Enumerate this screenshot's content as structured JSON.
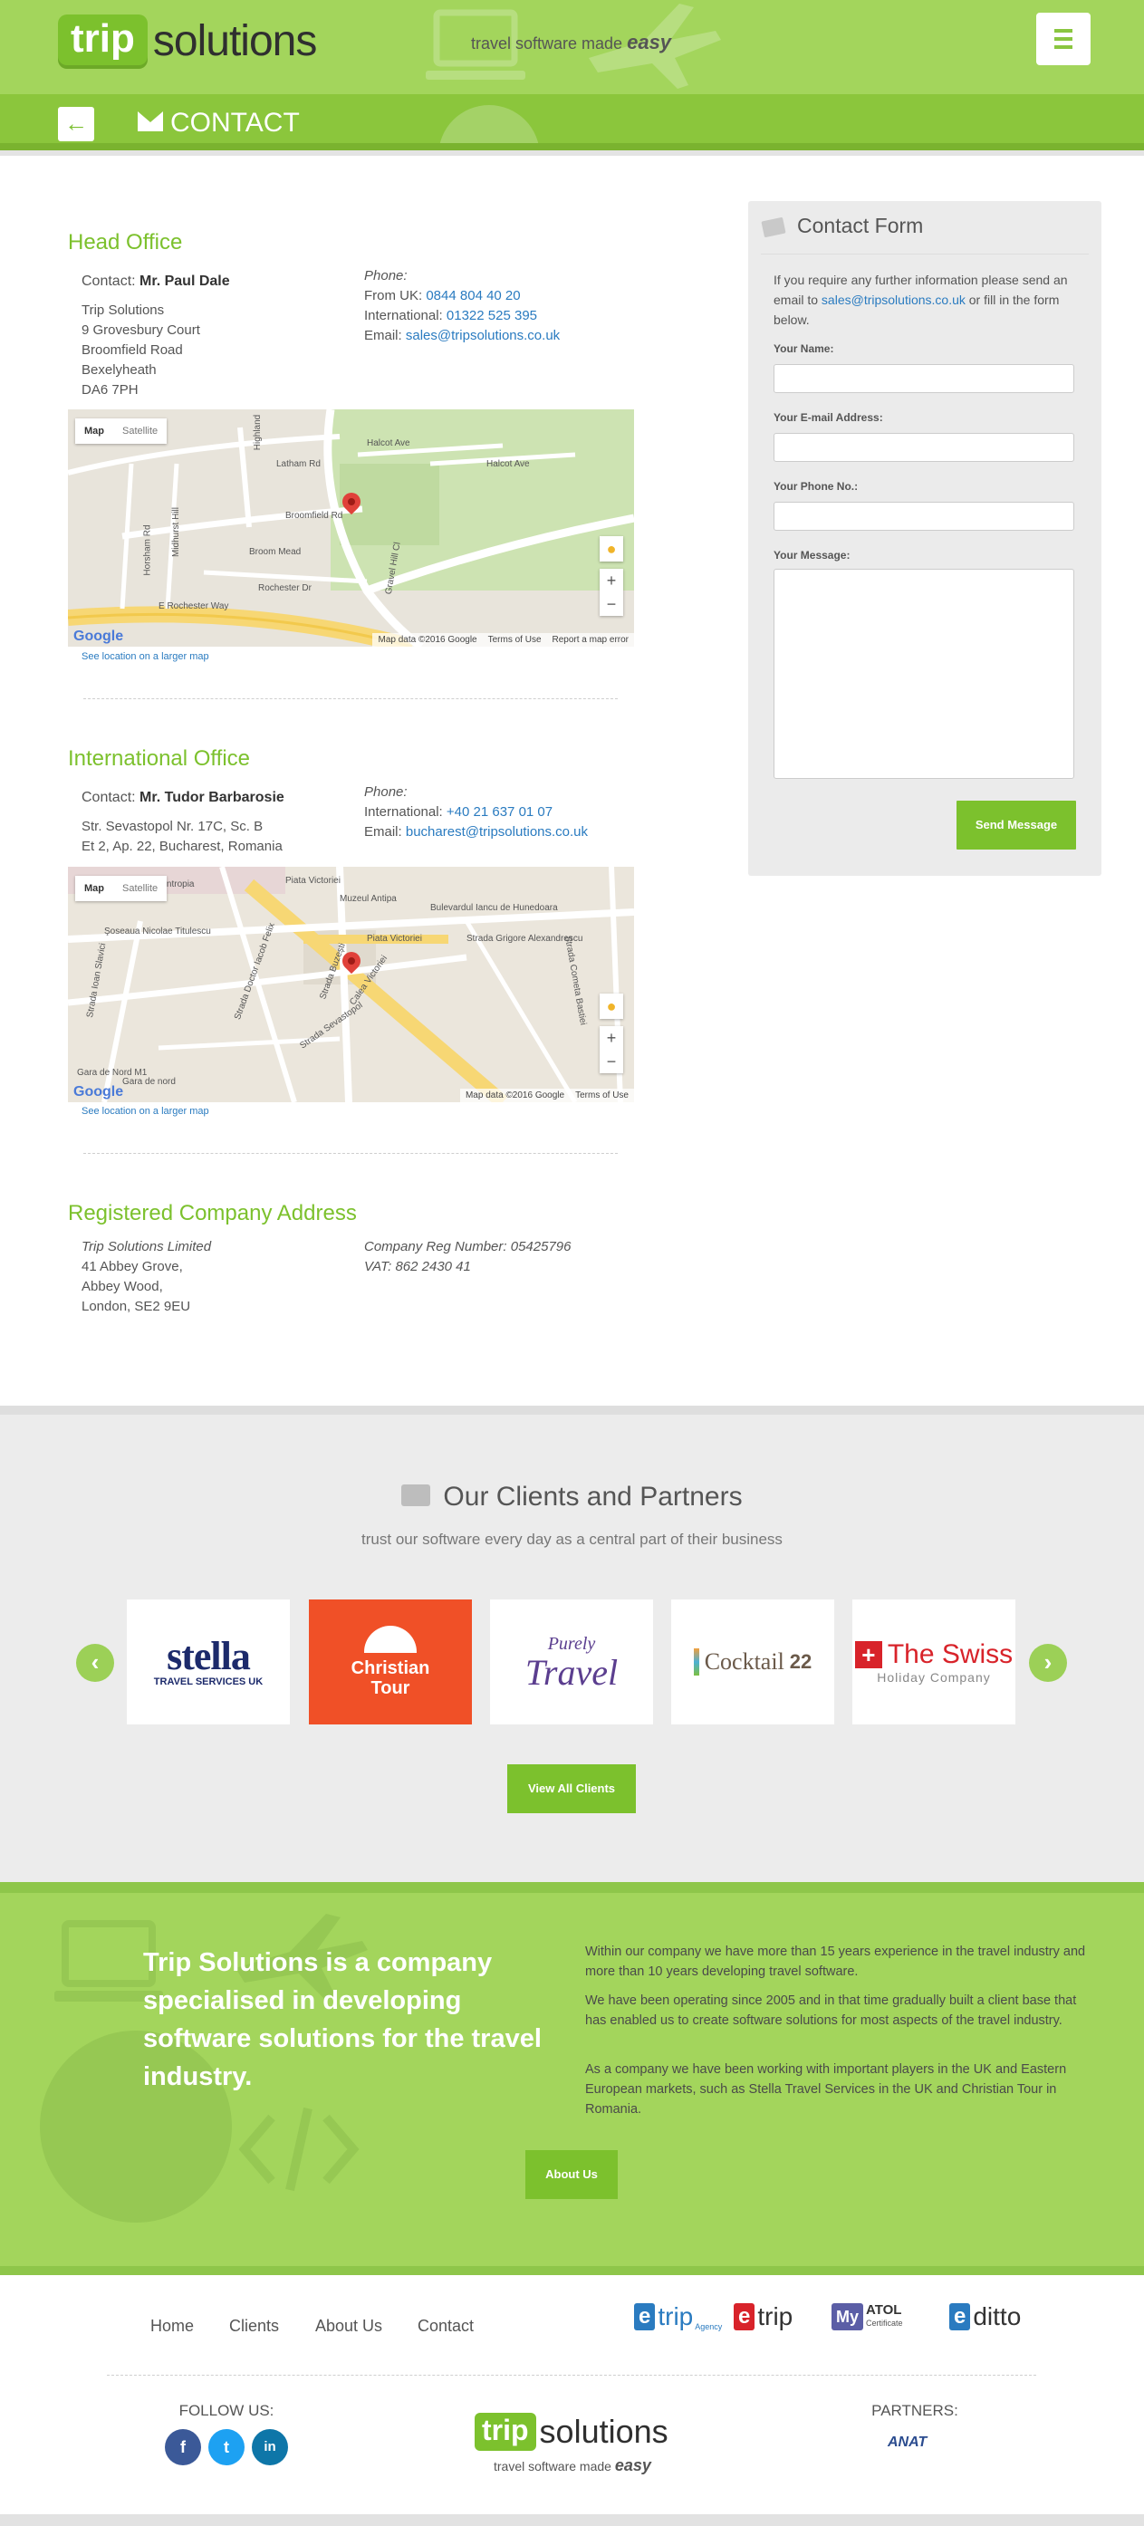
{
  "header": {
    "logo_trip": "trip",
    "logo_solutions": "solutions",
    "tagline": "travel software made",
    "tagline_em": "easy",
    "page_title": "CONTACT"
  },
  "head_office": {
    "title": "Head Office",
    "contact_label": "Contact:",
    "contact_name": "Mr. Paul Dale",
    "address": [
      "Trip Solutions",
      "9 Grovesbury Court",
      "Broomfield Road",
      "Bexelyheath",
      "DA6 7PH"
    ],
    "phone_label": "Phone:",
    "from_uk_label": "From UK:",
    "from_uk": "0844 804 40 20",
    "intl_label": "International:",
    "intl": "01322 525 395",
    "email_label": "Email:",
    "email": "sales@tripsolutions.co.uk",
    "map": {
      "tab_map": "Map",
      "tab_satellite": "Satellite",
      "streets": [
        "Latham Rd",
        "Halcot Ave",
        "Halcot Ave",
        "Broomfield Rd",
        "Broom Mead",
        "Rochester Dr",
        "E Rochester Way",
        "Gravel Hill Cl",
        "Horsham Rd",
        "Midhurst Hill",
        "Highland"
      ],
      "map_data": "Map data ©2016 Google",
      "terms": "Terms of Use",
      "report": "Report a map error",
      "google": "Google"
    },
    "see_larger": "See location on a larger map"
  },
  "intl_office": {
    "title": "International Office",
    "contact_label": "Contact:",
    "contact_name": "Mr. Tudor Barbarosie",
    "address": [
      "Str. Sevastopol Nr. 17C, Sc. B",
      "Et 2, Ap. 22, Bucharest, Romania"
    ],
    "phone_label": "Phone:",
    "intl_label": "International:",
    "intl": "+40 21 637 01 07",
    "email_label": "Email:",
    "email": "bucharest@tripsolutions.co.uk",
    "map": {
      "tab_map": "Map",
      "tab_satellite": "Satellite",
      "streets": [
        "Spitalul Clinic Filantropia",
        "Piata Victoriei",
        "Muzeul Antipa",
        "Bulevardul Iancu de Hunedoara",
        "Şoseaua Nicolae Titulescu",
        "Piata Victoriei",
        "Strada Grigore Alexandrescu",
        "Strada Doctor Iacob Felix",
        "Strada Buzești",
        "Calea Victoriei",
        "Strada Sevastopol",
        "Gara de Nord M1",
        "Gara de nord",
        "Strada Ioan Slavici",
        "Strada Cometa Bastiei"
      ],
      "map_data": "Map data ©2016 Google",
      "terms": "Terms of Use",
      "google": "Google"
    },
    "see_larger": "See location on a larger map"
  },
  "registered": {
    "title": "Registered Company Address",
    "company": "Trip Solutions Limited",
    "address": [
      "41 Abbey Grove,",
      "Abbey Wood,",
      "London, SE2 9EU"
    ],
    "reg_number": "Company Reg Number: 05425796",
    "vat": "VAT: 862 2430 41"
  },
  "contact_form": {
    "title": "Contact Form",
    "intro_1": "If you require any further information please send an email to",
    "intro_email": "sales@tripsolutions.co.uk",
    "intro_2": "or fill in the form below.",
    "name_label": "Your Name:",
    "email_label": "Your E-mail Address:",
    "phone_label": "Your Phone No.:",
    "message_label": "Your Message:",
    "name_value": "",
    "email_value": "",
    "phone_value": "",
    "message_value": "",
    "send_label": "Send Message"
  },
  "clients": {
    "title": "Our Clients and Partners",
    "subtitle": "trust our software every day as a central part of their business",
    "logos": [
      {
        "line1": "stella",
        "line2": "TRAVEL SERVICES UK"
      },
      {
        "line1": "Christian",
        "line2": "Tour"
      },
      {
        "line1": "Purely",
        "line2": "Travel"
      },
      {
        "line1": "Cocktail",
        "line2": "22"
      },
      {
        "line1": "The Swiss",
        "line2": "Holiday Company"
      }
    ],
    "view_all": "View All Clients",
    "prev": "‹",
    "next": "›"
  },
  "about": {
    "headline": "Trip Solutions is a company specialised in developing software solutions for the travel industry.",
    "p1": "Within our company we have more than 15 years experience in the travel industry and more than 10 years developing travel software.",
    "p2": "We have been operating since 2005 and in that time gradually built a client base that has enabled us to create software solutions for most aspects of the travel industry.",
    "p3": "As a company we have been working with important players in the UK and Eastern European markets, such as Stella Travel Services in the UK and Christian Tour in Romania.",
    "button": "About Us"
  },
  "footer": {
    "nav": [
      "Home",
      "Clients",
      "About Us",
      "Contact"
    ],
    "products": [
      {
        "box": "e",
        "name": "trip",
        "sub": "Agency"
      },
      {
        "box": "e",
        "name": "trip",
        "sub": ""
      },
      {
        "box": "My",
        "name": "ATOL",
        "sub": "Certificate"
      },
      {
        "box": "e",
        "name": "ditto",
        "sub": ""
      }
    ],
    "follow_us": "FOLLOW US:",
    "social": [
      "f",
      "t",
      "in"
    ],
    "logo_trip": "trip",
    "logo_solutions": "solutions",
    "tagline": "travel software made",
    "tagline_em": "easy",
    "partners": "PARTNERS:",
    "partner_name": "ANAT"
  },
  "colors": {
    "brand_green": "#7cc12d",
    "header_green": "#a3d55c",
    "link_blue": "#2a7bc0"
  }
}
